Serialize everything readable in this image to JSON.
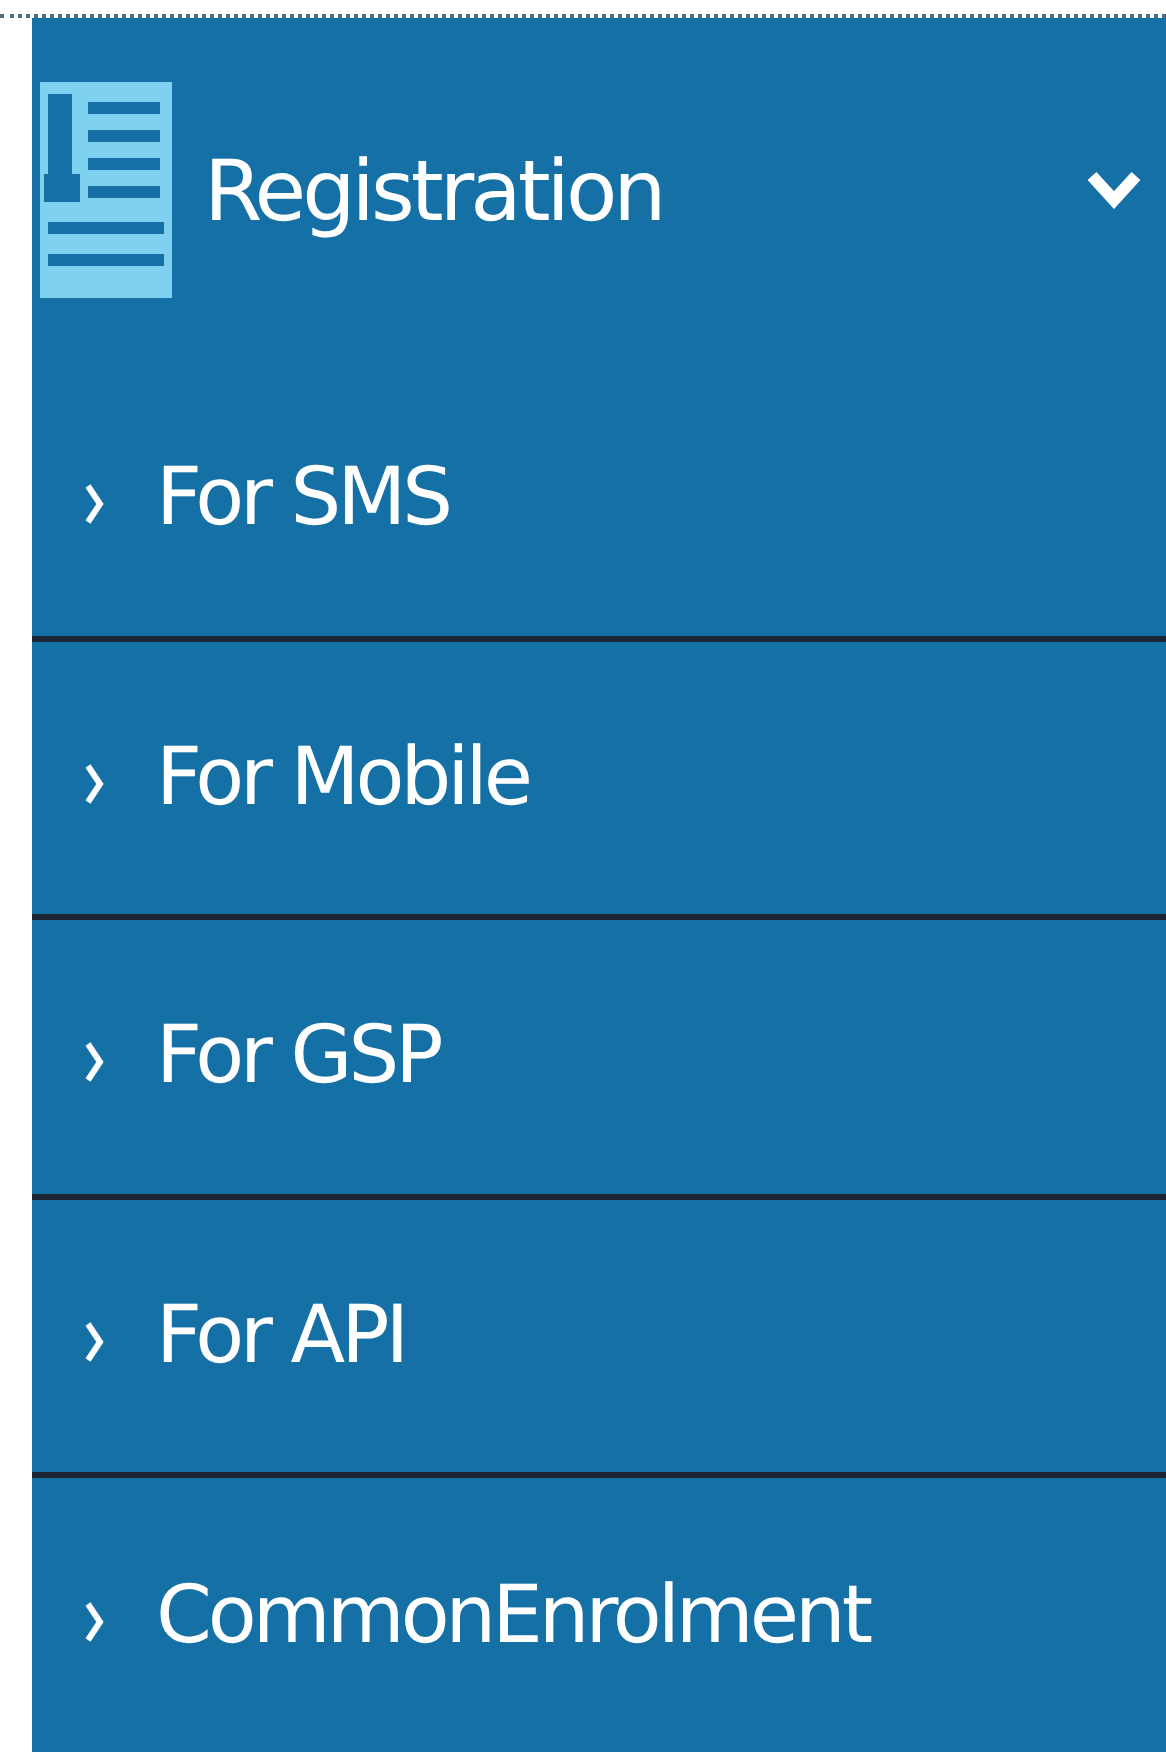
{
  "menu": {
    "title": "Registration",
    "expanded": true,
    "items": [
      {
        "label": "For SMS"
      },
      {
        "label": "For Mobile"
      },
      {
        "label": "For GSP"
      },
      {
        "label": "For API"
      },
      {
        "label": "CommonEnrolment"
      }
    ]
  }
}
